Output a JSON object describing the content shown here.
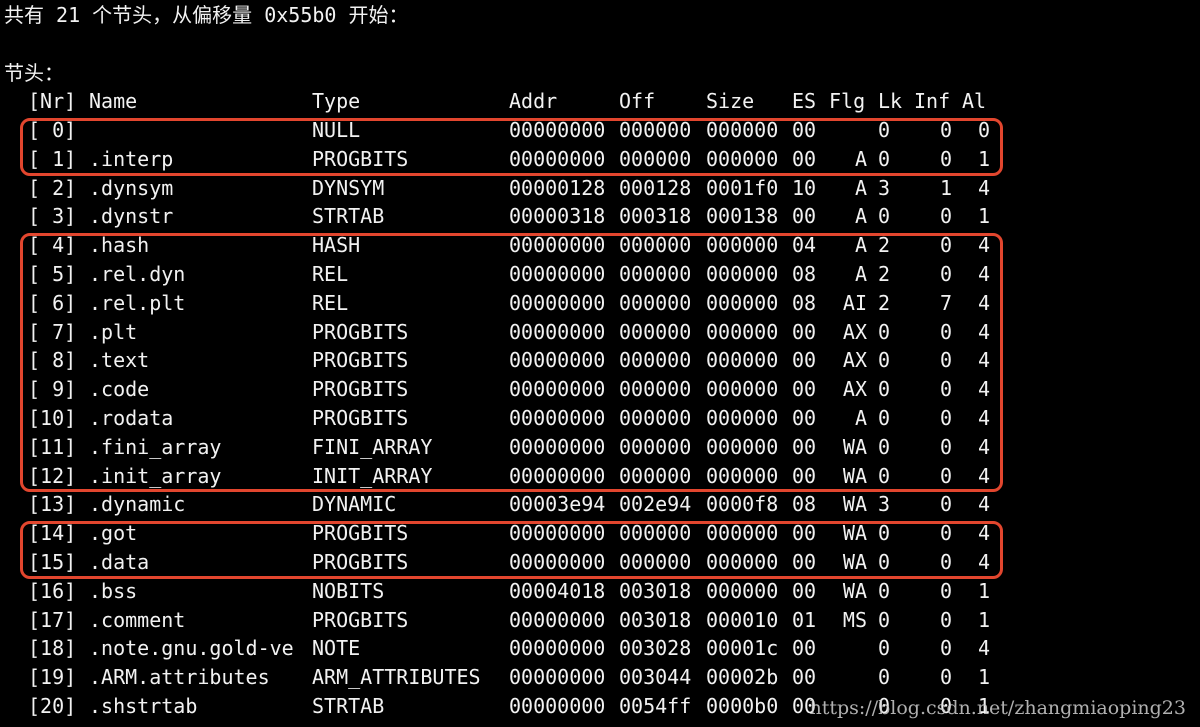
{
  "summary": "共有 21 个节头，从偏移量 0x55b0 开始：",
  "section_label": "节头：",
  "headers": {
    "nr": "[Nr]",
    "name": "Name",
    "type": "Type",
    "addr": "Addr",
    "off": "Off",
    "size": "Size",
    "es": "ES",
    "flg": "Flg",
    "lk": "Lk",
    "inf": "Inf",
    "al": "Al"
  },
  "rows": [
    {
      "nr": "[ 0]",
      "name": "",
      "type": "NULL",
      "addr": "00000000",
      "off": "000000",
      "size": "000000",
      "es": "00",
      "flg": "",
      "lk": "0",
      "inf": "0",
      "al": "0"
    },
    {
      "nr": "[ 1]",
      "name": ".interp",
      "type": "PROGBITS",
      "addr": "00000000",
      "off": "000000",
      "size": "000000",
      "es": "00",
      "flg": "A",
      "lk": "0",
      "inf": "0",
      "al": "1"
    },
    {
      "nr": "[ 2]",
      "name": ".dynsym",
      "type": "DYNSYM",
      "addr": "00000128",
      "off": "000128",
      "size": "0001f0",
      "es": "10",
      "flg": "A",
      "lk": "3",
      "inf": "1",
      "al": "4"
    },
    {
      "nr": "[ 3]",
      "name": ".dynstr",
      "type": "STRTAB",
      "addr": "00000318",
      "off": "000318",
      "size": "000138",
      "es": "00",
      "flg": "A",
      "lk": "0",
      "inf": "0",
      "al": "1"
    },
    {
      "nr": "[ 4]",
      "name": ".hash",
      "type": "HASH",
      "addr": "00000000",
      "off": "000000",
      "size": "000000",
      "es": "04",
      "flg": "A",
      "lk": "2",
      "inf": "0",
      "al": "4"
    },
    {
      "nr": "[ 5]",
      "name": ".rel.dyn",
      "type": "REL",
      "addr": "00000000",
      "off": "000000",
      "size": "000000",
      "es": "08",
      "flg": "A",
      "lk": "2",
      "inf": "0",
      "al": "4"
    },
    {
      "nr": "[ 6]",
      "name": ".rel.plt",
      "type": "REL",
      "addr": "00000000",
      "off": "000000",
      "size": "000000",
      "es": "08",
      "flg": "AI",
      "lk": "2",
      "inf": "7",
      "al": "4"
    },
    {
      "nr": "[ 7]",
      "name": ".plt",
      "type": "PROGBITS",
      "addr": "00000000",
      "off": "000000",
      "size": "000000",
      "es": "00",
      "flg": "AX",
      "lk": "0",
      "inf": "0",
      "al": "4"
    },
    {
      "nr": "[ 8]",
      "name": ".text",
      "type": "PROGBITS",
      "addr": "00000000",
      "off": "000000",
      "size": "000000",
      "es": "00",
      "flg": "AX",
      "lk": "0",
      "inf": "0",
      "al": "4"
    },
    {
      "nr": "[ 9]",
      "name": ".code",
      "type": "PROGBITS",
      "addr": "00000000",
      "off": "000000",
      "size": "000000",
      "es": "00",
      "flg": "AX",
      "lk": "0",
      "inf": "0",
      "al": "4"
    },
    {
      "nr": "[10]",
      "name": ".rodata",
      "type": "PROGBITS",
      "addr": "00000000",
      "off": "000000",
      "size": "000000",
      "es": "00",
      "flg": "A",
      "lk": "0",
      "inf": "0",
      "al": "4"
    },
    {
      "nr": "[11]",
      "name": ".fini_array",
      "type": "FINI_ARRAY",
      "addr": "00000000",
      "off": "000000",
      "size": "000000",
      "es": "00",
      "flg": "WA",
      "lk": "0",
      "inf": "0",
      "al": "4"
    },
    {
      "nr": "[12]",
      "name": ".init_array",
      "type": "INIT_ARRAY",
      "addr": "00000000",
      "off": "000000",
      "size": "000000",
      "es": "00",
      "flg": "WA",
      "lk": "0",
      "inf": "0",
      "al": "4"
    },
    {
      "nr": "[13]",
      "name": ".dynamic",
      "type": "DYNAMIC",
      "addr": "00003e94",
      "off": "002e94",
      "size": "0000f8",
      "es": "08",
      "flg": "WA",
      "lk": "3",
      "inf": "0",
      "al": "4"
    },
    {
      "nr": "[14]",
      "name": ".got",
      "type": "PROGBITS",
      "addr": "00000000",
      "off": "000000",
      "size": "000000",
      "es": "00",
      "flg": "WA",
      "lk": "0",
      "inf": "0",
      "al": "4"
    },
    {
      "nr": "[15]",
      "name": ".data",
      "type": "PROGBITS",
      "addr": "00000000",
      "off": "000000",
      "size": "000000",
      "es": "00",
      "flg": "WA",
      "lk": "0",
      "inf": "0",
      "al": "4"
    },
    {
      "nr": "[16]",
      "name": ".bss",
      "type": "NOBITS",
      "addr": "00004018",
      "off": "003018",
      "size": "000000",
      "es": "00",
      "flg": "WA",
      "lk": "0",
      "inf": "0",
      "al": "1"
    },
    {
      "nr": "[17]",
      "name": ".comment",
      "type": "PROGBITS",
      "addr": "00000000",
      "off": "003018",
      "size": "000010",
      "es": "01",
      "flg": "MS",
      "lk": "0",
      "inf": "0",
      "al": "1"
    },
    {
      "nr": "[18]",
      "name": ".note.gnu.gold-ve",
      "type": "NOTE",
      "addr": "00000000",
      "off": "003028",
      "size": "00001c",
      "es": "00",
      "flg": "",
      "lk": "0",
      "inf": "0",
      "al": "4"
    },
    {
      "nr": "[19]",
      "name": ".ARM.attributes",
      "type": "ARM_ATTRIBUTES",
      "addr": "00000000",
      "off": "003044",
      "size": "00002b",
      "es": "00",
      "flg": "",
      "lk": "0",
      "inf": "0",
      "al": "1"
    },
    {
      "nr": "[20]",
      "name": ".shstrtab",
      "type": "STRTAB",
      "addr": "00000000",
      "off": "0054ff",
      "size": "0000b0",
      "es": "00",
      "flg": "",
      "lk": "0",
      "inf": "0",
      "al": "1"
    }
  ],
  "highlight_groups": [
    {
      "first_row": 0,
      "last_row": 1
    },
    {
      "first_row": 4,
      "last_row": 12
    },
    {
      "first_row": 14,
      "last_row": 15
    }
  ],
  "highlight_color": "#e2462e",
  "watermark": "https://blog.csdn.net/zhangmiaoping23"
}
